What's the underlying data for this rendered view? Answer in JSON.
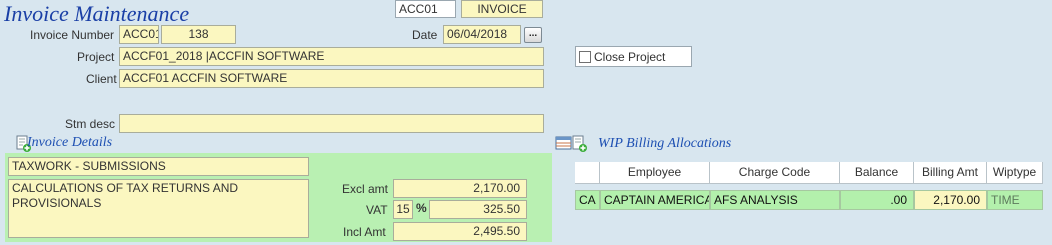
{
  "window": {
    "title": "Invoice Maintenance"
  },
  "header": {
    "account_code": "ACC01",
    "doc_type": "INVOICE",
    "invoice_number_label": "Invoice Number",
    "invoice_prefix": "ACC01",
    "invoice_number": "138",
    "date_label": "Date",
    "date_value": "06/04/2018",
    "date_button": "...",
    "project_label": "Project",
    "project_value": "ACCF01_2018 |ACCFIN SOFTWARE",
    "client_label": "Client",
    "client_value": "ACCF01 ACCFIN SOFTWARE",
    "close_project_label": "Close Project",
    "stm_desc_label": "Stm desc",
    "stm_desc_value": ""
  },
  "invoice_details": {
    "section_title": "Invoice Details",
    "line_title": "TAXWORK - SUBMISSIONS",
    "line_desc": "CALCULATIONS OF TAX RETURNS AND PROVISIONALS",
    "excl_label": "Excl amt",
    "excl_value": "2,170.00",
    "vat_label": "VAT",
    "vat_rate": "15",
    "vat_pct_sign": "%",
    "vat_value": "325.50",
    "incl_label": "Incl Amt",
    "incl_value": "2,495.50"
  },
  "wip": {
    "section_title": "WIP Billing Allocations",
    "columns": [
      "",
      "Employee",
      "Charge Code",
      "Balance",
      "Billing Amt",
      "Wiptype"
    ],
    "rows": [
      {
        "code": "CA",
        "employee": "CAPTAIN AMERICA",
        "charge_code": "AFS ANALYSIS",
        "balance": ".00",
        "billing_amt": "2,170.00",
        "wiptype": "TIME"
      }
    ]
  },
  "colors": {
    "field_bg": "#fbf7c0",
    "panel_green": "#b9f0b2",
    "row_green": "#b3f0ac",
    "title_blue": "#1a3fa6",
    "background": "#d8e6ef"
  },
  "icons": {
    "details_icon": "document-add-icon",
    "wip_icon": "grid-document-icon"
  }
}
